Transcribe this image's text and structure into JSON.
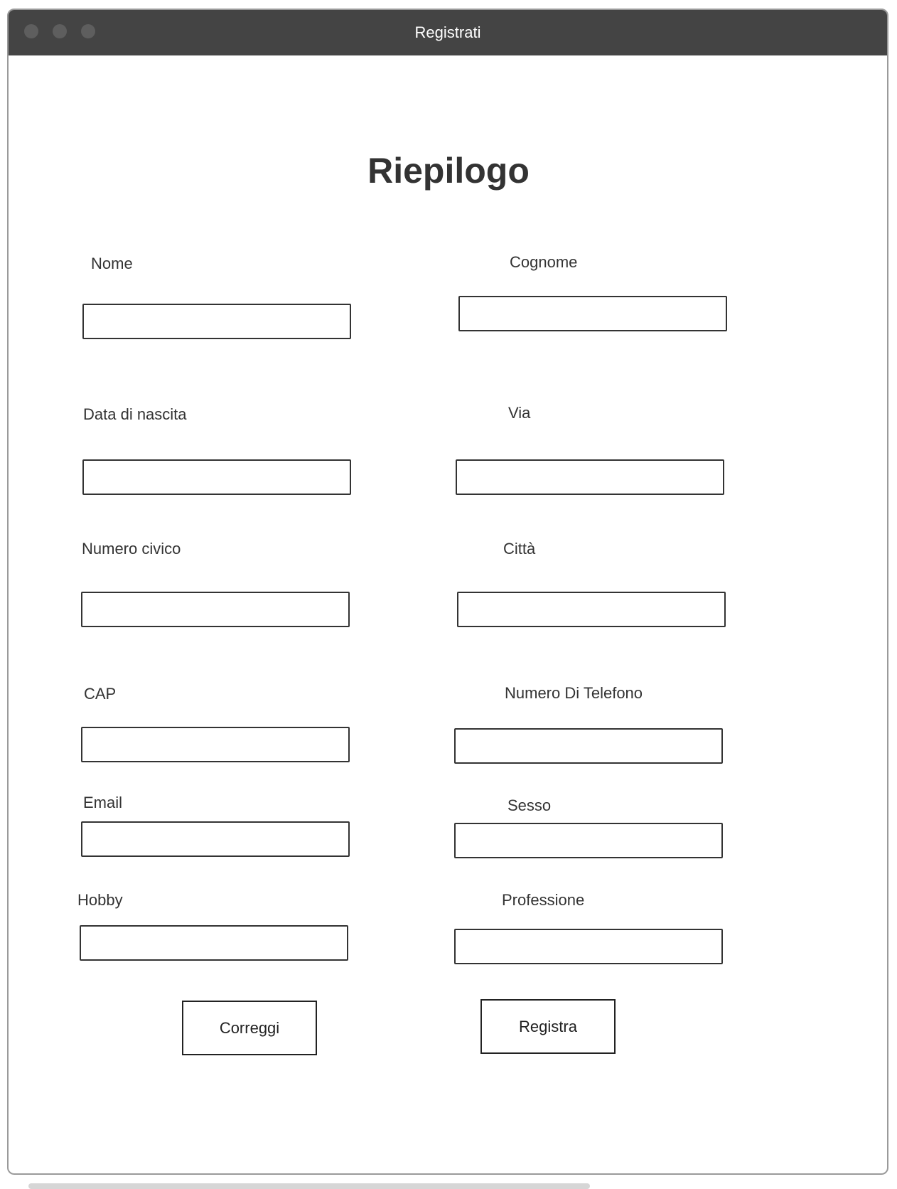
{
  "window": {
    "title": "Registrati"
  },
  "page": {
    "title": "Riepilogo"
  },
  "form": {
    "nome": {
      "label": "Nome",
      "value": ""
    },
    "cognome": {
      "label": "Cognome",
      "value": ""
    },
    "data_nascita": {
      "label": "Data di nascita",
      "value": ""
    },
    "via": {
      "label": "Via",
      "value": ""
    },
    "numero_civico": {
      "label": "Numero civico",
      "value": ""
    },
    "citta": {
      "label": "Città",
      "value": ""
    },
    "cap": {
      "label": "CAP",
      "value": ""
    },
    "telefono": {
      "label": "Numero Di Telefono",
      "value": ""
    },
    "email": {
      "label": "Email",
      "value": ""
    },
    "sesso": {
      "label": "Sesso",
      "value": ""
    },
    "hobby": {
      "label": "Hobby",
      "value": ""
    },
    "professione": {
      "label": "Professione",
      "value": ""
    }
  },
  "actions": {
    "correggi_label": "Correggi",
    "registra_label": "Registra"
  },
  "colors": {
    "titlebar": "#444444",
    "window_title_text": "#ffffff",
    "border": "#333333",
    "text": "#333333"
  }
}
